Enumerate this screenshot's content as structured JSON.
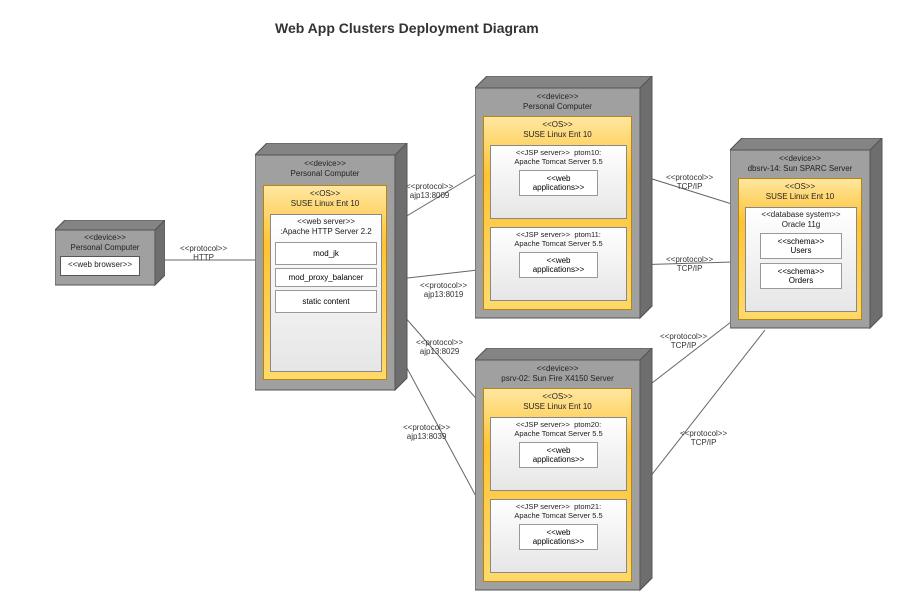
{
  "title": "Web App Clusters Deployment Diagram",
  "stereotypes": {
    "device": "<<device>>",
    "os": "<<OS>>",
    "webserver": "<<web server>>",
    "webbrowser": "<<web browser>>",
    "jsp": "<<JSP server>>",
    "dbsys": "<<database system>>",
    "schema": "<<schema>>",
    "web_apps": "<<web\napplications>>",
    "protocol": "<<protocol>>"
  },
  "nodes": {
    "client": {
      "name": "Personal Computer"
    },
    "http_server": {
      "name": "Personal Computer",
      "os": "SUSE Linux Ent 10",
      "server": ":Apache HTTP Server 2.2",
      "mods": [
        "mod_jk",
        "mod_proxy_balancer",
        "static content"
      ]
    },
    "top_pc": {
      "name": "Personal Computer",
      "os": "SUSE Linux Ent 10",
      "jsp1": "ptom10:\nApache Tomcat Server 5.5",
      "jsp2": "ptom11:\nApache Tomcat Server 5.5"
    },
    "bottom_srv": {
      "name": "psrv-02: Sun Fire X4150 Server",
      "os": "SUSE Linux Ent 10",
      "jsp1": "ptom20:\nApache Tomcat Server 5.5",
      "jsp2": "ptom21:\nApache Tomcat Server 5.5"
    },
    "db": {
      "name": "dbsrv-14: Sun SPARC Server",
      "os": "SUSE Linux Ent 10",
      "dbsys": "Oracle 11g",
      "schema1": "Users",
      "schema2": "Orders"
    }
  },
  "connections": {
    "http": "HTTP",
    "ajp1": "ajp13:8009",
    "ajp2": "ajp13:8019",
    "ajp3": "ajp13:8029",
    "ajp4": "ajp13:8039",
    "tcp": "TCP/IP"
  }
}
